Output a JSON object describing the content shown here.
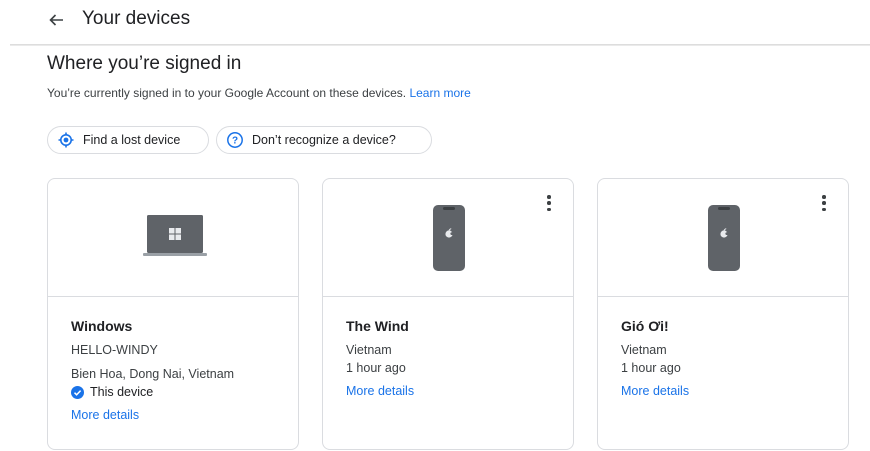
{
  "header": {
    "title": "Your devices"
  },
  "section": {
    "title": "Where you’re signed in",
    "description": "You’re currently signed in to your Google Account on these devices.",
    "learn_more": "Learn more"
  },
  "actions": {
    "find_lost_device": "Find a lost device",
    "dont_recognize": "Don’t recognize a device?"
  },
  "devices": [
    {
      "icon": "windows-laptop-icon",
      "name": "Windows",
      "hostname": "HELLO-WINDY",
      "location": "Bien Hoa, Dong Nai, Vietnam",
      "badge": "This device",
      "more_details": "More details"
    },
    {
      "icon": "iphone-icon",
      "name": "The Wind",
      "location": "Vietnam",
      "last_seen": "1 hour ago",
      "more_details": "More details"
    },
    {
      "icon": "iphone-icon",
      "name": "Gió Ơi!",
      "location": "Vietnam",
      "last_seen": "1 hour ago",
      "more_details": "More details"
    }
  ],
  "colors": {
    "link": "#1a73e8",
    "border": "#dadce0",
    "text": "#202124"
  }
}
